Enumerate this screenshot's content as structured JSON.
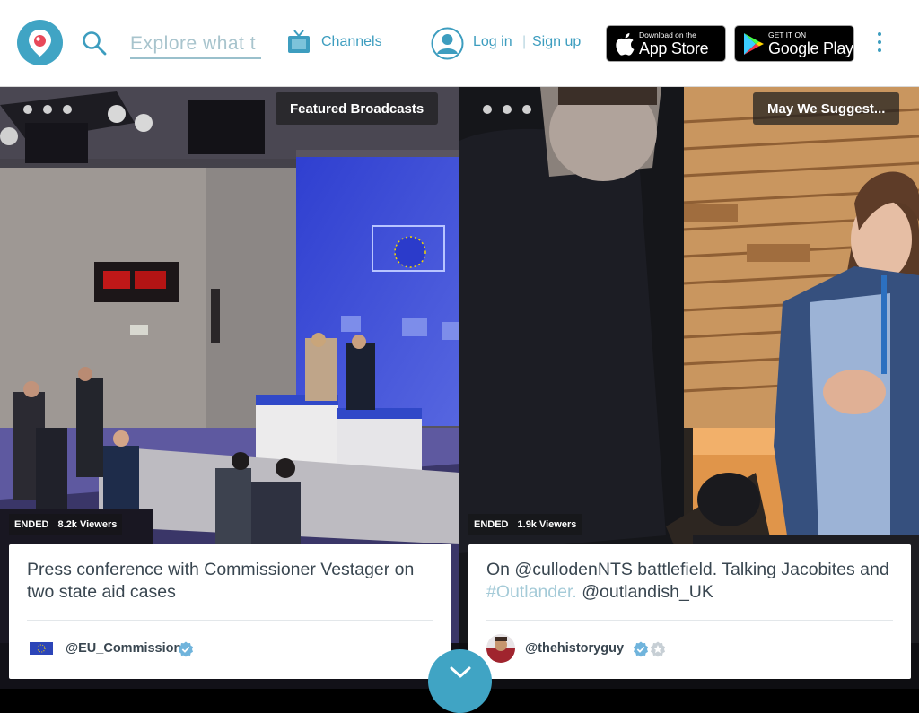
{
  "header": {
    "search_placeholder": "Explore what t",
    "channels_label": "Channels",
    "login_label": "Log in",
    "separator": "|",
    "signup_label": "Sign up",
    "appstore": {
      "small": "Download on the",
      "big": "App Store"
    },
    "googleplay": {
      "small": "GET IT ON",
      "big": "Google Play"
    },
    "accent_color": "#40a4c4"
  },
  "panels": [
    {
      "label": "Featured Broadcasts",
      "status": "ENDED",
      "viewers": "8.2k Viewers",
      "title": "Press conference with Commissioner Vestager on two state aid cases",
      "username": "@EU_Commission",
      "verified": true,
      "star": false
    },
    {
      "label": "May We Suggest...",
      "status": "ENDED",
      "viewers": "1.9k Viewers",
      "title_part1": "On @cullodenNTS battlefield. Talking Jacobites and ",
      "title_hashtag": "#Outlander.",
      "title_part2": " @outlandish_UK",
      "username": "@thehistoryguy",
      "verified": true,
      "star": true
    }
  ]
}
